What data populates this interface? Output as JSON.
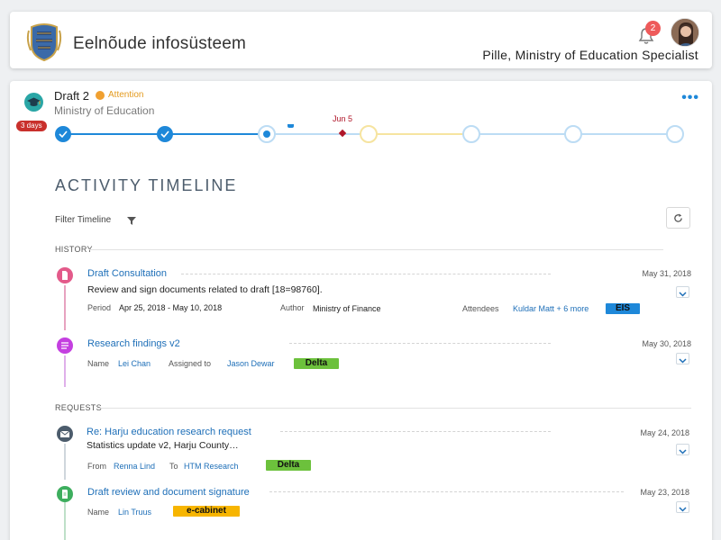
{
  "header": {
    "app_title": "Eelnõude infosüsteem",
    "user_label": "Pille, Ministry of Education Specialist",
    "notification_count": "2"
  },
  "draft": {
    "title": "Draft 2",
    "attention_label": "Attention",
    "ministry": "Ministry of Education",
    "days_badge": "3 days",
    "milestone_date": "Jun 5"
  },
  "colors": {
    "primary": "#1e88d9",
    "attention": "#f0a030",
    "danger": "#c9302c",
    "tag_delta": "#6cc13c",
    "tag_eis": "#1e88d9",
    "tag_ecabinet": "#f7b500"
  },
  "timeline": {
    "title": "ACTIVITY TIMELINE",
    "filter_label": "Filter Timeline",
    "history_label": "HISTORY",
    "requests_label": "REQUESTS"
  },
  "history": [
    {
      "title": "Draft Consultation",
      "date": "May 31, 2018",
      "description": "Review and sign documents related to draft [18=98760].",
      "period_label": "Period",
      "period_value": "Apr 25, 2018 - May 10, 2018",
      "author_label": "Author",
      "author_value": "Ministry of Finance",
      "attendees_label": "Attendees",
      "attendees_value": "Kuldar Matt + 6 more",
      "tag": "EIS",
      "icon": "document-icon"
    },
    {
      "title": "Research findings v2",
      "date": "May 30, 2018",
      "name_label": "Name",
      "name_value": "Lei Chan",
      "assigned_label": "Assigned to",
      "assigned_value": "Jason Dewar",
      "tag": "Delta",
      "icon": "list-icon"
    }
  ],
  "requests": [
    {
      "title": "Re: Harju education research request",
      "date": "May 24, 2018",
      "description": "Statistics update v2, Harju County…",
      "from_label": "From",
      "from_value": "Renna Lind",
      "to_label": "To",
      "to_value": "HTM Research",
      "tag": "Delta",
      "icon": "mail-icon"
    },
    {
      "title": "Draft review and document signature",
      "date": "May 23, 2018",
      "name_label": "Name",
      "name_value": "Lin Truus",
      "tag": "e-cabinet",
      "icon": "signature-icon"
    }
  ]
}
